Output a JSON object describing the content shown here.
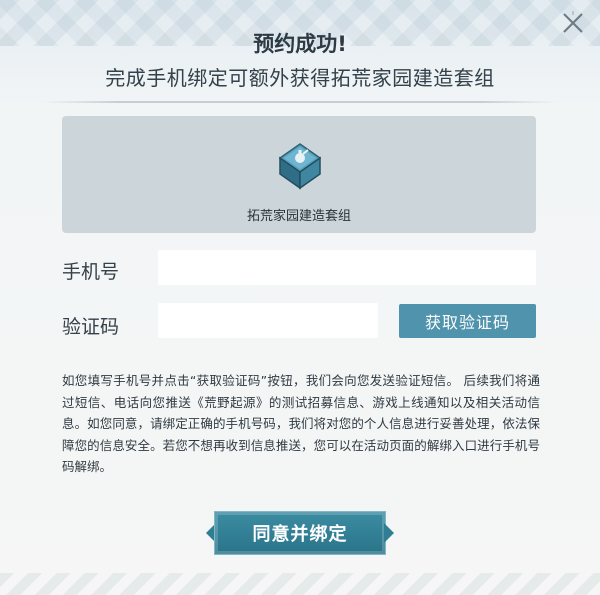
{
  "dialog": {
    "title": "预约成功!",
    "subtitle": "完成手机绑定可额外获得拓荒家园建造套组",
    "close_icon": "close-icon"
  },
  "reward": {
    "icon": "reward-box-icon",
    "label": "拓荒家园建造套组"
  },
  "form": {
    "phone_label": "手机号",
    "phone_value": "",
    "phone_placeholder": "",
    "code_label": "验证码",
    "code_value": "",
    "code_placeholder": "",
    "get_code_button": "获取验证码"
  },
  "notice": {
    "text": "如您填写手机号并点击“获取验证码”按钮，我们会向您发送验证短信。 后续我们将通过短信、电话向您推送《荒野起源》的测试招募信息、游戏上线通知以及相关活动信息。如您同意，请绑定正确的手机号码，我们将对您的个人信息进行妥善处理，依法保障您的信息安全。若您不想再收到信息推送，您可以在活动页面的解绑入口进行手机号码解绑。"
  },
  "actions": {
    "agree_button": "同意并绑定"
  },
  "colors": {
    "accent": "#4f93ad",
    "agree_button": "#2f7e93",
    "reward_box_bg": "#ccd5da",
    "title_text": "#2d3a44"
  }
}
